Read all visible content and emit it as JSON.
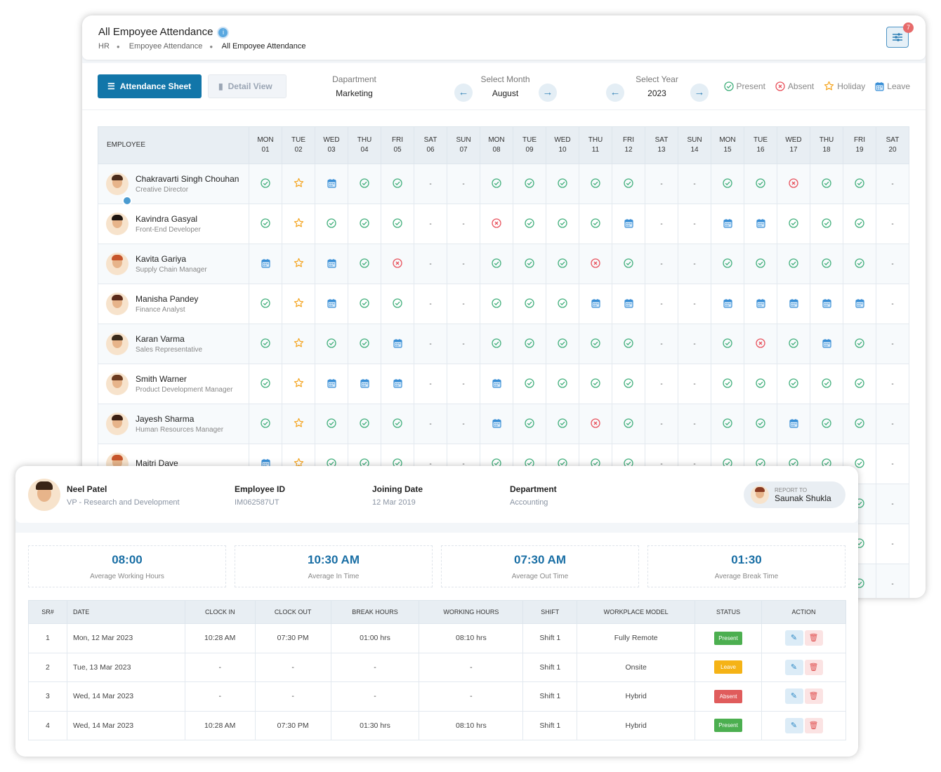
{
  "header": {
    "title": "All Empoyee Attendance",
    "breadcrumb": [
      "HR",
      "Empoyee Attendance",
      "All Empoyee Attendance"
    ],
    "filter_count": "7"
  },
  "toolbar": {
    "attendance_sheet": "Attendance Sheet",
    "detail_view": "Detail View",
    "department_label": "Dapartment",
    "department": "Marketing",
    "month_label": "Select Month",
    "month": "August",
    "year_label": "Select Year",
    "year": "2023"
  },
  "legend": {
    "present": "Present",
    "absent": "Absent",
    "holiday": "Holiday",
    "leave": "Leave"
  },
  "colors": {
    "present": "#3fae7a",
    "absent": "#e8505b",
    "holiday": "#f5a623",
    "leave": "#3a8fd6",
    "primary": "#1276a9"
  },
  "grid": {
    "employee_header": "EMPLOYEE",
    "days": [
      [
        "MON",
        "01"
      ],
      [
        "TUE",
        "02"
      ],
      [
        "WED",
        "03"
      ],
      [
        "THU",
        "04"
      ],
      [
        "FRI",
        "05"
      ],
      [
        "SAT",
        "06"
      ],
      [
        "SUN",
        "07"
      ],
      [
        "MON",
        "08"
      ],
      [
        "TUE",
        "09"
      ],
      [
        "WED",
        "10"
      ],
      [
        "THU",
        "11"
      ],
      [
        "FRI",
        "12"
      ],
      [
        "SAT",
        "13"
      ],
      [
        "SUN",
        "14"
      ],
      [
        "MON",
        "15"
      ],
      [
        "TUE",
        "16"
      ],
      [
        "WED",
        "17"
      ],
      [
        "THU",
        "18"
      ],
      [
        "FRI",
        "19"
      ],
      [
        "SAT",
        "20"
      ]
    ],
    "rows": [
      {
        "name": "Chakravarti Singh Chouhan",
        "role": "Creative Director",
        "birthday": true,
        "status": "P H L P P - - P P P P P - - P P A P P -"
      },
      {
        "name": "Kavindra Gasyal",
        "role": "Front-End Developer",
        "status": "P H P P P - - A P P P L - - L L P P P -"
      },
      {
        "name": "Kavita Gariya",
        "role": "Supply Chain Manager",
        "status": "L H L P A - - P P P A P - - P P P P P -"
      },
      {
        "name": "Manisha Pandey",
        "role": "Finance Analyst",
        "status": "P H L P P - - P P P L L - - L L L L L -"
      },
      {
        "name": "Karan Varma",
        "role": "Sales Representative",
        "status": "P H P P L - - P P P P P - - P A P L P -"
      },
      {
        "name": "Smith Warner",
        "role": "Product Development Manager",
        "status": "P H L L L - - L P P P P - - P P P P P -"
      },
      {
        "name": "Jayesh Sharma",
        "role": "Human Resources Manager",
        "status": "P H P P P - - L P P A P - - P P L P P -"
      },
      {
        "name": "Maitri Dave",
        "role": "",
        "status": "L H P P P - - P P P P P - - P P P P P -"
      },
      {
        "name": "",
        "role": "",
        "status": "? ? ? ? ? ? ? ? ? ? ? ? ? ? ? ? ? ? P -"
      },
      {
        "name": "",
        "role": "",
        "status": "? ? ? ? ? ? ? ? ? ? ? ? ? ? ? ? ? ? P -"
      },
      {
        "name": "",
        "role": "",
        "status": "? ? ? ? ? ? ? ? ? ? ? ? ? ? ? ? ? ? P -"
      }
    ]
  },
  "profile": {
    "name": "Neel Patel",
    "role": "VP - Research and Development",
    "employee_id_label": "Employee ID",
    "employee_id": "IM062587UT",
    "joining_label": "Joining Date",
    "joining": "12 Mar 2019",
    "department_label": "Department",
    "department": "Accounting",
    "report_to_label": "REPORT TO",
    "report_to": "Saunak Shukla"
  },
  "stats": [
    {
      "value": "08:00",
      "label": "Average Working Hours"
    },
    {
      "value": "10:30 AM",
      "label": "Average In Time"
    },
    {
      "value": "07:30 AM",
      "label": "Average Out Time"
    },
    {
      "value": "01:30",
      "label": "Average Break Time"
    }
  ],
  "attendance": {
    "columns": [
      "SR#",
      "DATE",
      "CLOCK IN",
      "CLOCK OUT",
      "BREAK HOURS",
      "WORKING HOURS",
      "SHIFT",
      "WORKPLACE MODEL",
      "STATUS",
      "ACTION"
    ],
    "rows": [
      [
        "1",
        "Mon, 12 Mar 2023",
        "10:28 AM",
        "07:30 PM",
        "01:00 hrs",
        "08:10 hrs",
        "Shift 1",
        "Fully Remote",
        "Present"
      ],
      [
        "2",
        "Tue, 13 Mar 2023",
        "-",
        "-",
        "-",
        "-",
        "Shift 1",
        "Onsite",
        "Leave"
      ],
      [
        "3",
        "Wed, 14 Mar 2023",
        "-",
        "-",
        "-",
        "-",
        "Shift 1",
        "Hybrid",
        "Absent"
      ],
      [
        "4",
        "Wed, 14 Mar 2023",
        "10:28 AM",
        "07:30 PM",
        "01:30 hrs",
        "08:10 hrs",
        "Shift 1",
        "Hybrid",
        "Present"
      ]
    ]
  },
  "status_colors": {
    "Present": "#4caf50",
    "Leave": "#f5b316",
    "Absent": "#e05c5c"
  }
}
